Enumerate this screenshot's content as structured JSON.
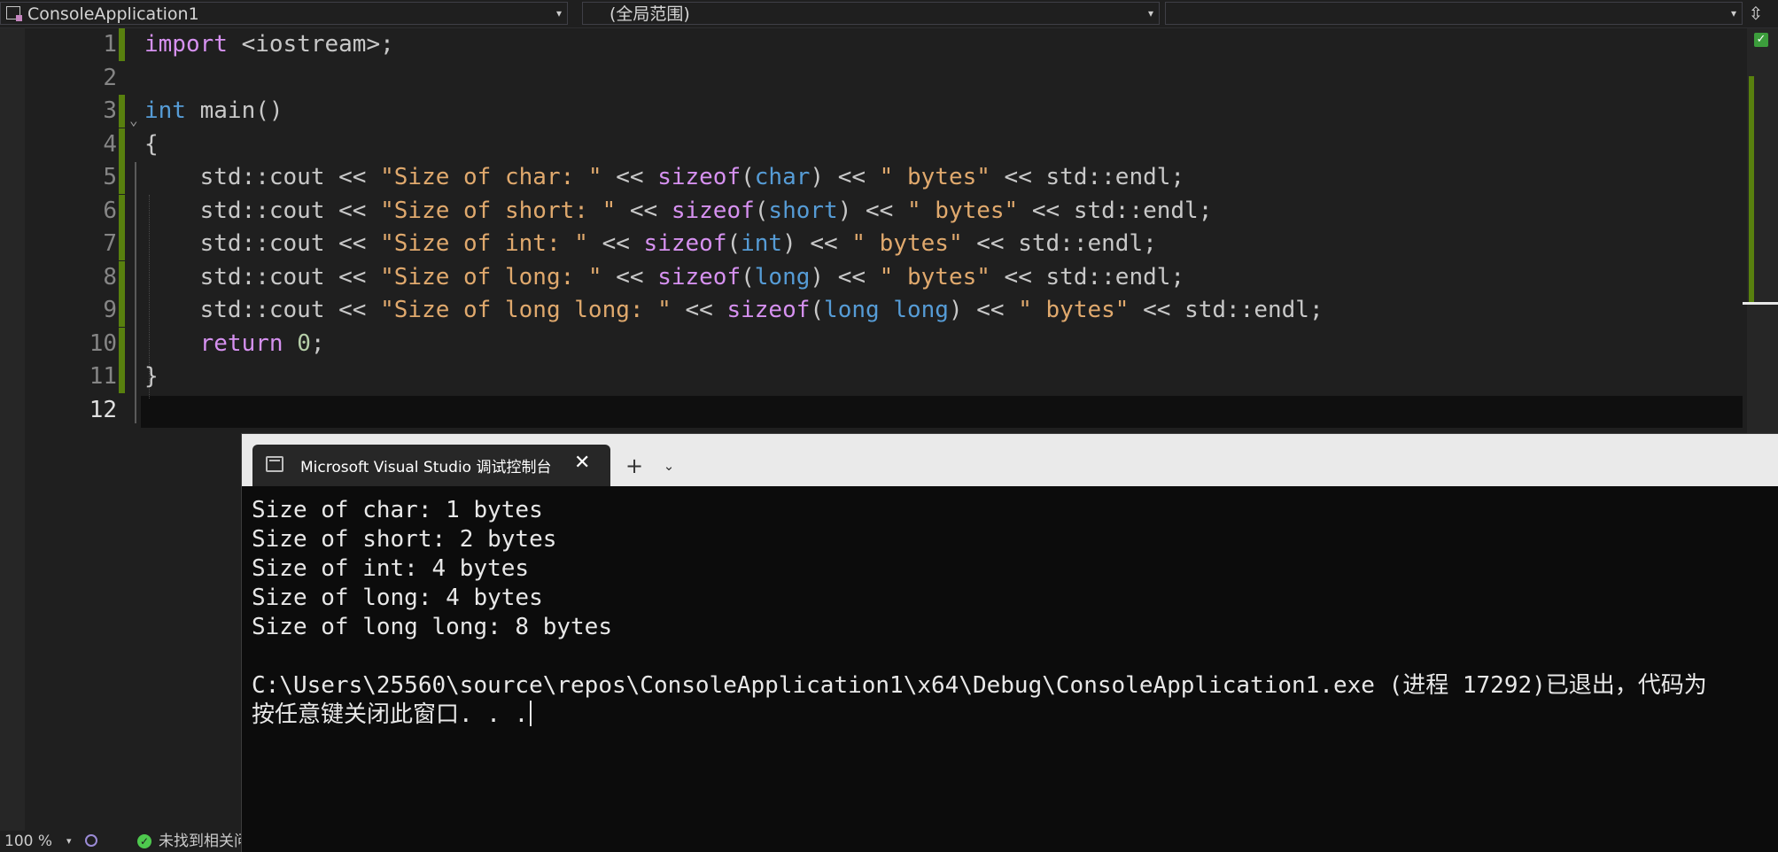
{
  "navbar": {
    "project_name": "ConsoleApplication1",
    "scope": "(全局范围)",
    "member": ""
  },
  "editor": {
    "code_lines": [
      {
        "num": "1",
        "tokens": [
          {
            "t": "import ",
            "c": "kw"
          },
          {
            "t": "<iostream>;",
            "c": "id"
          }
        ]
      },
      {
        "num": "2",
        "tokens": []
      },
      {
        "num": "3",
        "tokens": [
          {
            "t": "int",
            "c": "ty"
          },
          {
            "t": " main()",
            "c": "id"
          }
        ]
      },
      {
        "num": "4",
        "tokens": [
          {
            "t": "{",
            "c": "id"
          }
        ]
      },
      {
        "num": "5",
        "tokens": [
          {
            "t": "    std::cout << ",
            "c": "id"
          },
          {
            "t": "\"Size of char: \"",
            "c": "str"
          },
          {
            "t": " << ",
            "c": "id"
          },
          {
            "t": "sizeof",
            "c": "kw"
          },
          {
            "t": "(",
            "c": "id"
          },
          {
            "t": "char",
            "c": "ty"
          },
          {
            "t": ") << ",
            "c": "id"
          },
          {
            "t": "\" bytes\"",
            "c": "str"
          },
          {
            "t": " << std::endl;",
            "c": "id"
          }
        ]
      },
      {
        "num": "6",
        "tokens": [
          {
            "t": "    std::cout << ",
            "c": "id"
          },
          {
            "t": "\"Size of short: \"",
            "c": "str"
          },
          {
            "t": " << ",
            "c": "id"
          },
          {
            "t": "sizeof",
            "c": "kw"
          },
          {
            "t": "(",
            "c": "id"
          },
          {
            "t": "short",
            "c": "ty"
          },
          {
            "t": ") << ",
            "c": "id"
          },
          {
            "t": "\" bytes\"",
            "c": "str"
          },
          {
            "t": " << std::endl;",
            "c": "id"
          }
        ]
      },
      {
        "num": "7",
        "tokens": [
          {
            "t": "    std::cout << ",
            "c": "id"
          },
          {
            "t": "\"Size of int: \"",
            "c": "str"
          },
          {
            "t": " << ",
            "c": "id"
          },
          {
            "t": "sizeof",
            "c": "kw"
          },
          {
            "t": "(",
            "c": "id"
          },
          {
            "t": "int",
            "c": "ty"
          },
          {
            "t": ") << ",
            "c": "id"
          },
          {
            "t": "\" bytes\"",
            "c": "str"
          },
          {
            "t": " << std::endl;",
            "c": "id"
          }
        ]
      },
      {
        "num": "8",
        "tokens": [
          {
            "t": "    std::cout << ",
            "c": "id"
          },
          {
            "t": "\"Size of long: \"",
            "c": "str"
          },
          {
            "t": " << ",
            "c": "id"
          },
          {
            "t": "sizeof",
            "c": "kw"
          },
          {
            "t": "(",
            "c": "id"
          },
          {
            "t": "long",
            "c": "ty"
          },
          {
            "t": ") << ",
            "c": "id"
          },
          {
            "t": "\" bytes\"",
            "c": "str"
          },
          {
            "t": " << std::endl;",
            "c": "id"
          }
        ]
      },
      {
        "num": "9",
        "tokens": [
          {
            "t": "    std::cout << ",
            "c": "id"
          },
          {
            "t": "\"Size of long long: \"",
            "c": "str"
          },
          {
            "t": " << ",
            "c": "id"
          },
          {
            "t": "sizeof",
            "c": "kw"
          },
          {
            "t": "(",
            "c": "id"
          },
          {
            "t": "long long",
            "c": "ty"
          },
          {
            "t": ") << ",
            "c": "id"
          },
          {
            "t": "\" bytes\"",
            "c": "str"
          },
          {
            "t": " << std::endl;",
            "c": "id"
          }
        ]
      },
      {
        "num": "10",
        "tokens": [
          {
            "t": "    ",
            "c": "id"
          },
          {
            "t": "return",
            "c": "kw"
          },
          {
            "t": " ",
            "c": "id"
          },
          {
            "t": "0",
            "c": "num"
          },
          {
            "t": ";",
            "c": "id"
          }
        ]
      },
      {
        "num": "11",
        "tokens": [
          {
            "t": "}",
            "c": "id"
          }
        ]
      },
      {
        "num": "12",
        "tokens": []
      }
    ],
    "current_line": "12"
  },
  "console": {
    "tab_title": "Microsoft Visual Studio 调试控制台",
    "new_tab_glyph": "+",
    "menu_glyph": "⌄",
    "close_glyph": "✕",
    "output_lines": [
      "Size of char: 1 bytes",
      "Size of short: 2 bytes",
      "Size of int: 4 bytes",
      "Size of long: 4 bytes",
      "Size of long long: 8 bytes",
      "",
      "C:\\Users\\25560\\source\\repos\\ConsoleApplication1\\x64\\Debug\\ConsoleApplication1.exe (进程 17292)已退出，代码为",
      "按任意键关闭此窗口. . ."
    ]
  },
  "statusbar": {
    "zoom": "100 %",
    "issues": "未找到相关问"
  },
  "colors": {
    "keyword": "#d691f0",
    "type": "#569cd6",
    "string": "#e0a96d",
    "number": "#b5cea8",
    "change_marker": "#58800e"
  },
  "icons": {
    "project": "project-icon",
    "split": "split-icon",
    "ok": "check-icon",
    "console_tab": "terminal-icon"
  }
}
